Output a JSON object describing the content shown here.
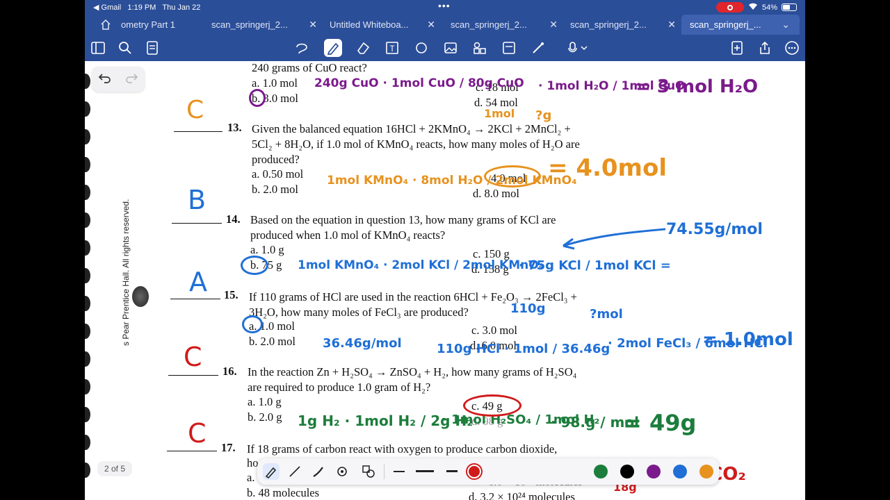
{
  "status": {
    "app_back": "◀ Gmail",
    "time": "1:19 PM",
    "date": "Thu Jan 22",
    "battery": "54%",
    "battery_level": 0.54
  },
  "tabs": [
    {
      "label": "ometry Part 1"
    },
    {
      "label": "scan_springerj_2..."
    },
    {
      "label": "Untitled Whiteboa..."
    },
    {
      "label": "scan_springerj_2..."
    },
    {
      "label": "scan_springerj_2..."
    },
    {
      "label": "scan_springerj_..."
    }
  ],
  "colors": {
    "bar": "#2b4e98",
    "purple": "#7b1a8c",
    "orange": "#e7921e",
    "blue": "#1f6fd6",
    "red": "#d01b1b",
    "green": "#1c7d3c"
  },
  "pager": "2 of 5",
  "sidebar_text": "s Pear Prentice Hall. All rights reserved.",
  "worksheet": {
    "q12_tail": "240 grams of CuO react?",
    "q12_a": "a.  1.0 mol",
    "q12_b": "b.  3.0 mol",
    "q12_c": "c.  18 mol",
    "q12_d": "d.  54 mol",
    "q13_num": "13.",
    "q13_l1": "Given the balanced equation 16HCl + 2KMnO₄ → 2KCl + 2MnCl₂ +",
    "q13_l2": "5Cl₂ + 8H₂O, if 1.0 mol of KMnO₄ reacts, how many moles of H₂O are",
    "q13_l3": "produced?",
    "q13_a": "a.  0.50 mol",
    "q13_b": "b.  2.0 mol",
    "q13_c": "4.0 mol",
    "q13_d": "d.  8.0 mol",
    "q14_num": "14.",
    "q14_l1": "Based on the equation in question 13, how many grams of KCl are",
    "q14_l2": "produced when 1.0 mol of KMnO₄ reacts?",
    "q14_a": "a.  1.0 g",
    "q14_b": "b.  75 g",
    "q14_c": "c.  150 g",
    "q14_d": "d.  158 g",
    "q15_num": "15.",
    "q15_l1": "If 110 grams of HCl are used in the reaction 6HCl + Fe₂O₃ → 2FeCl₃ +",
    "q15_l2": "3H₂O, how many moles of FeCl₃ are produced?",
    "q15_a": "a.  1.0 mol",
    "q15_b": "b.  2.0 mol",
    "q15_c": "c.  3.0 mol",
    "q15_d": "d.  6.0 mol",
    "q16_num": "16.",
    "q16_l1": "In the reaction Zn + H₂SO₄ → ZnSO₄ + H₂, how many grams of H₂SO₄",
    "q16_l2": "are required to produce 1.0 gram of H₂?",
    "q16_a": "a.  1.0 g",
    "q16_b": "b.  2.0 g",
    "q16_c": "c.  49 g",
    "q16_d": "d.  98 g",
    "q17_num": "17.",
    "q17_l1": "If 18 grams of carbon react with oxygen to produce carbon dioxide,",
    "q17_l2": "ho",
    "q17_a": "a.",
    "q17_b": "b.  48 molecules",
    "q17_c": "6.0 × 10²³ molecules",
    "q17_d": "d.  3.2 × 10²⁴ molecules"
  },
  "handwriting": {
    "q12_calc": "240g CuO · 1mol CuO / 80g CuO",
    "q12_calc2": "· 1mol H₂O / 1mol CuO",
    "q12_ans": "= 3 mol H₂O",
    "q13_letter": "C",
    "q13_calc": "1mol KMnO₄ · 8mol H₂O / 2mol KMnO₄",
    "q13_ans": "= 4.0mol",
    "q13_note1": "1mol",
    "q13_note2": "?g",
    "q14_letter": "B",
    "q14_calc": "1mol KMnO₄ · 2mol KCl / 2mol KMnO₄",
    "q14_calc2": "· 75g KCl / 1mol KCl =",
    "q14_mass": "74.55g/mol",
    "q15_letter": "A",
    "q15_mass": "36.46g/mol",
    "q15_note": "110g",
    "q15_note2": "?mol",
    "q15_calc": "110g HCl · 1mol / 36.46g",
    "q15_calc2": "· 2mol FeCl₃ / 6mol HCl",
    "q15_ans": "= 1.0mol",
    "q16_letter": "C",
    "q16_calc": "1g H₂ · 1mol H₂ / 2g H₂",
    "q16_calc2": "· 1mol H₂SO₄ / 1mol H₂",
    "q16_calc3": "· 98.g / mol",
    "q16_ans": "= 49g",
    "q17_letter": "C",
    "q17_eq": "+ O₂ → CO₂",
    "q17_note": "18g"
  }
}
